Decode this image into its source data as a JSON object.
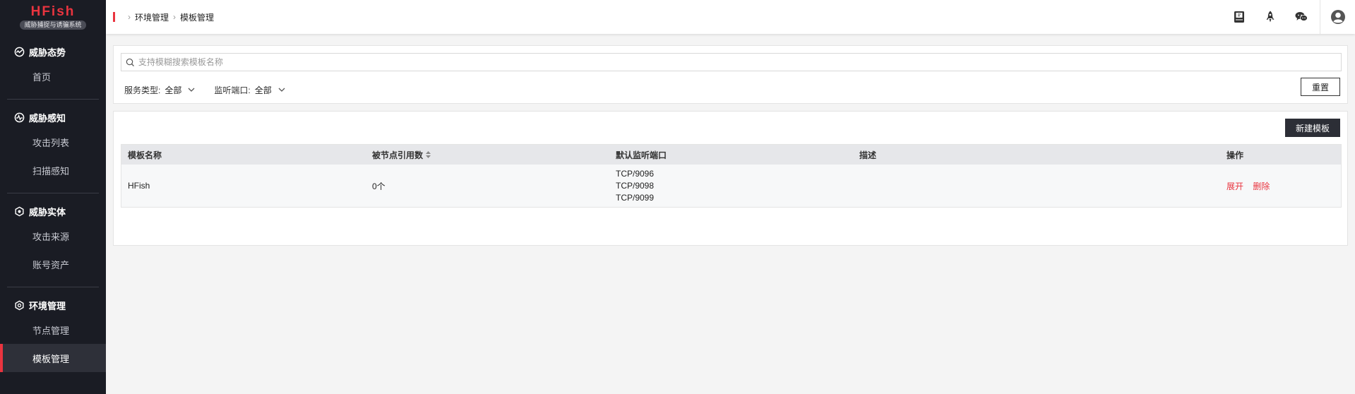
{
  "app": {
    "logo_title": "HFish",
    "logo_subtitle": "威胁捕捉与诱骗系统"
  },
  "sidebar": {
    "groups": [
      {
        "title": "威胁态势",
        "icon": "dashboard-icon",
        "items": [
          "首页"
        ]
      },
      {
        "title": "威胁感知",
        "icon": "radar-icon",
        "items": [
          "攻击列表",
          "扫描感知"
        ]
      },
      {
        "title": "威胁实体",
        "icon": "hexagon-icon",
        "items": [
          "攻击来源",
          "账号资产"
        ]
      },
      {
        "title": "环境管理",
        "icon": "hexagon-icon",
        "items": [
          "节点管理",
          "模板管理"
        ]
      }
    ],
    "active_item": "模板管理"
  },
  "header": {
    "breadcrumb": [
      "环境管理",
      "模板管理"
    ],
    "icons": [
      "book-icon",
      "rocket-icon",
      "wechat-icon",
      "user-avatar-icon"
    ]
  },
  "filter": {
    "search_placeholder": "支持模糊搜索模板名称",
    "service_type_label": "服务类型:",
    "service_type_value": "全部",
    "port_label": "监听端口:",
    "port_value": "全部",
    "reset_label": "重置"
  },
  "table": {
    "new_button": "新建模板",
    "columns": [
      "模板名称",
      "被节点引用数",
      "默认监听端口",
      "描述",
      "操作"
    ],
    "rows": [
      {
        "name": "HFish",
        "ref_count": "0个",
        "ports": [
          "TCP/9096",
          "TCP/9098",
          "TCP/9099"
        ],
        "description": "",
        "actions": [
          "展开",
          "删除"
        ]
      }
    ]
  },
  "colors": {
    "brand": "#e9343f",
    "sidebar_bg": "#1a1c24",
    "primary_button": "#2c2e36"
  }
}
